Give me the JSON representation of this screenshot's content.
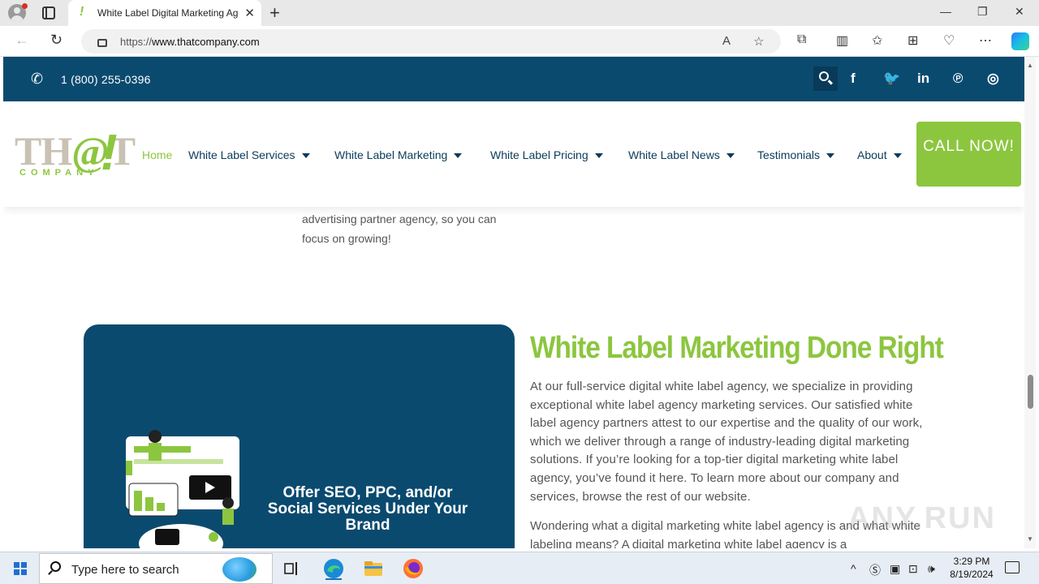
{
  "browser": {
    "tab_title": "White Label Digital Marketing Ag",
    "tab_favicon": "!",
    "url_prefix": "https://",
    "url_host": "www.thatcompany.com",
    "icons": [
      "back-icon",
      "reload-icon",
      "lock-icon",
      "read-aloud-icon",
      "favorite-icon",
      "extensions-icon",
      "split-screen-icon",
      "favorites-icon",
      "collections-icon",
      "performance-icon",
      "more-icon",
      "copilot-icon"
    ]
  },
  "site": {
    "topbar": {
      "phone": "1 (800) 255-0396",
      "social": [
        "facebook-icon",
        "twitter-icon",
        "linkedin-icon",
        "pinterest-icon",
        "instagram-icon"
      ]
    },
    "logo": {
      "main_left": "TH",
      "main_at": "@",
      "main_right": "T",
      "bang": "!",
      "sub": "COMPANY"
    },
    "nav": [
      {
        "label": "Home"
      },
      {
        "label": "White Label Services"
      },
      {
        "label": "White Label Marketing"
      },
      {
        "label": "White Label Pricing"
      },
      {
        "label": "White Label News"
      },
      {
        "label": "Testimonials"
      },
      {
        "label": "About"
      }
    ],
    "cta": "CALL NOW!"
  },
  "content": {
    "partial_top": "advertising partner agency, so you can focus on growing!",
    "card_text": "Offer SEO, PPC, and/or Social Services Under Your Brand",
    "title": "White Label Marketing Done Right",
    "body": "At our full-service digital white label agency, we specialize in providing exceptional white label agency marketing services. Our satisfied white label agency partners attest to our expertise and the quality of our work, which we deliver through a range of industry-leading digital marketing solutions. If you’re looking for a top-tier digital marketing white label agency, you’ve found it here. To learn more about our company and services, browse the rest of our website.",
    "body2": "Wondering what a digital marketing white label agency is and what white labeling means? A digital marketing white label agency is a"
  },
  "watermark": "ANY.RUN",
  "taskbar": {
    "search_placeholder": "Type here to search",
    "time": "3:29 PM",
    "date": "8/19/2024"
  },
  "colors": {
    "brand_blue": "#0b4a6f",
    "brand_green": "#8cc63f"
  }
}
